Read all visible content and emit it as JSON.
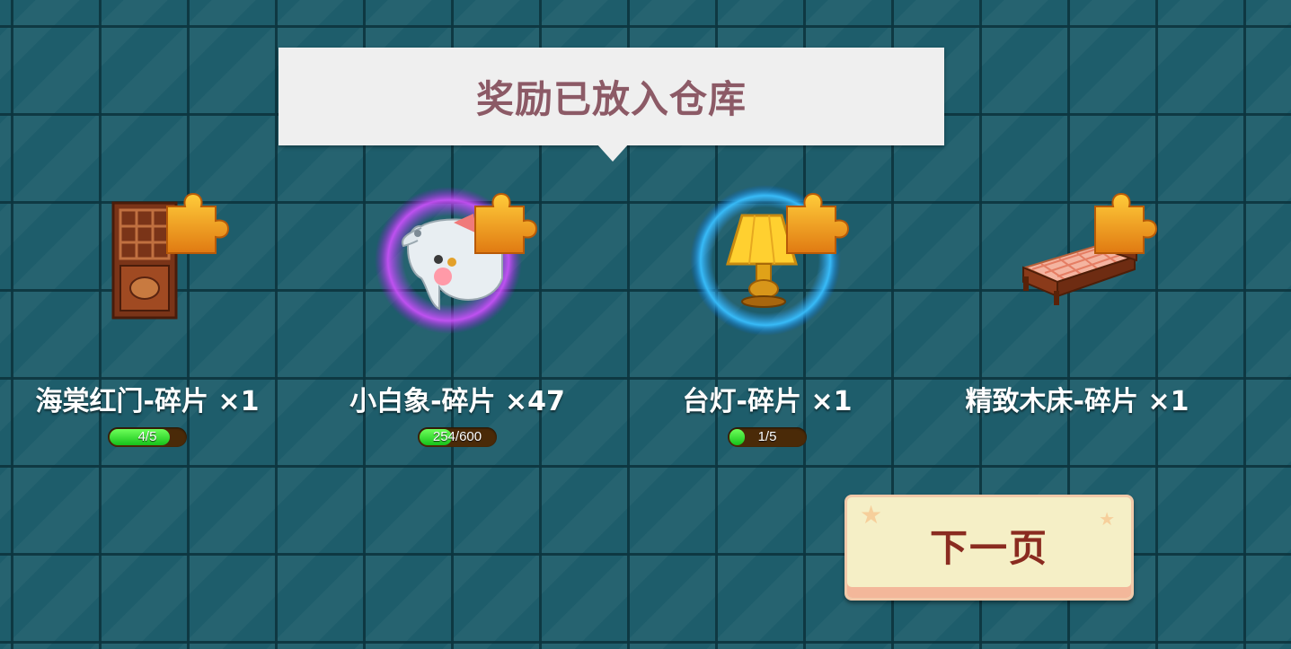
{
  "banner": {
    "title": "奖励已放入仓库"
  },
  "rewards": [
    {
      "name": "海棠红门-碎片 ×1",
      "item_icon": "red-wooden-door-icon",
      "has_progress": true,
      "progress_text": "4/5",
      "progress_fraction": 0.8
    },
    {
      "name": "小白象-碎片 ×47",
      "item_icon": "white-elephant-icon",
      "glow_color": "#c23cff",
      "has_progress": true,
      "progress_text": "254/600",
      "progress_fraction": 0.423
    },
    {
      "name": "台灯-碎片 ×1",
      "item_icon": "table-lamp-icon",
      "glow_color": "#27a8ff",
      "has_progress": true,
      "progress_text": "1/5",
      "progress_fraction": 0.2
    },
    {
      "name": "精致木床-碎片 ×1",
      "item_icon": "wooden-bed-icon",
      "has_progress": false
    }
  ],
  "fragment_icon": "puzzle-piece-icon",
  "next_button": {
    "label": "下一页"
  },
  "colors": {
    "background": "#1e5d6b",
    "banner_text": "#8c5a66",
    "progress_fill": "#16c21a",
    "button_text": "#8a2b20"
  }
}
